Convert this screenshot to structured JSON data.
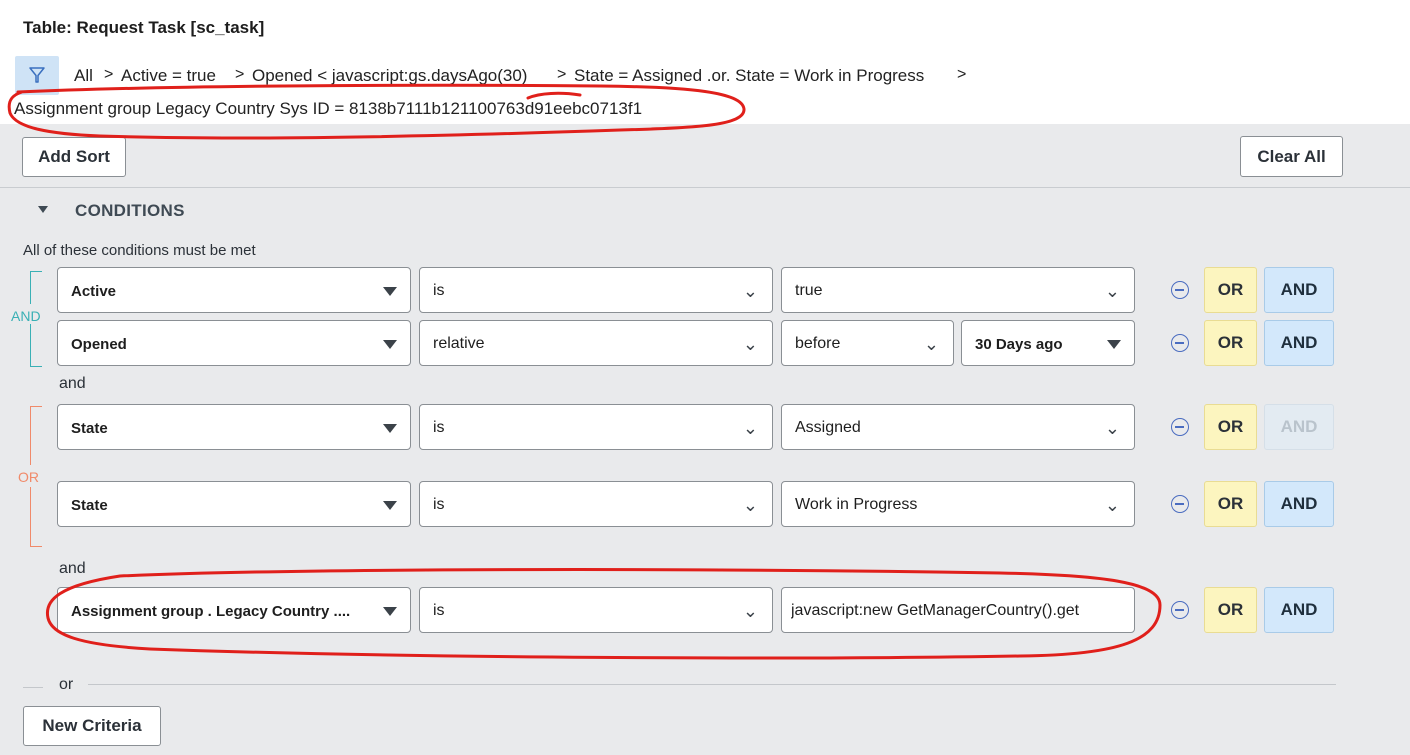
{
  "header": {
    "title": "Table: Request Task [sc_task]"
  },
  "breadcrumb": {
    "items": [
      "All",
      "Active = true",
      "Opened < javascript:gs.daysAgo(30)",
      "State = Assigned .or. State = Work in Progress"
    ],
    "separator": ">",
    "line2": "Assignment group Legacy Country Sys ID = 8138b7111b121100763d91eebc0713f1"
  },
  "toolbar": {
    "add_sort": "Add Sort",
    "clear_all": "Clear All"
  },
  "conditions": {
    "heading": "CONDITIONS",
    "hint": "All of these conditions must be met",
    "group_and_label": "AND",
    "group_or_label": "OR",
    "and_word": "and",
    "or_word": "or",
    "or_label": "OR",
    "and_label": "AND",
    "rows": [
      {
        "field": "Active",
        "operator": "is",
        "value": "true"
      },
      {
        "field": "Opened",
        "operator": "relative",
        "value": "before",
        "value2": "30 Days ago"
      },
      {
        "field": "State",
        "operator": "is",
        "value": "Assigned"
      },
      {
        "field": "State",
        "operator": "is",
        "value": "Work in Progress"
      },
      {
        "field": "Assignment group . Legacy Country ....",
        "operator": "is",
        "value": "javascript:new GetManagerCountry().get"
      }
    ]
  },
  "footer": {
    "new_criteria": "New Criteria"
  },
  "colors": {
    "annotation_red": "#e0201b",
    "and_group_teal": "#3ab0b5",
    "or_group_orange": "#f08a6a",
    "filter_icon_bg": "#cfe3f6"
  }
}
